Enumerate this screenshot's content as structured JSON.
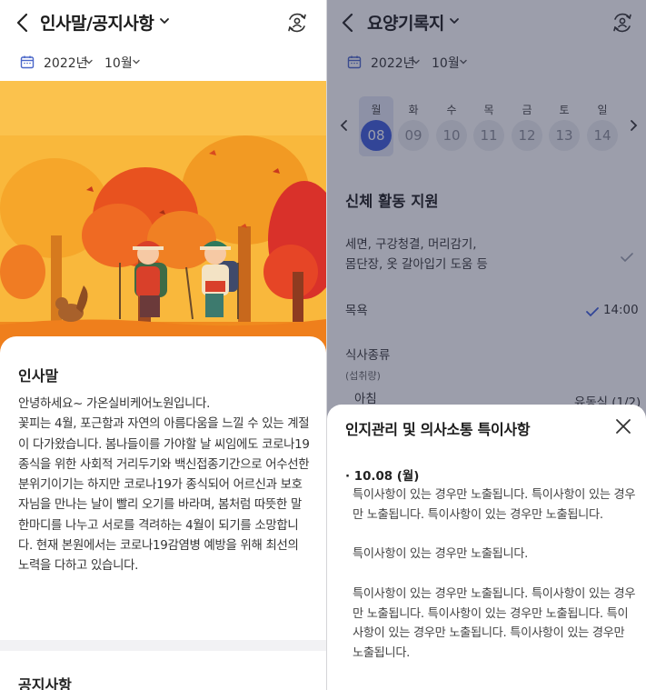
{
  "left": {
    "header": {
      "title": "인사말/공지사항",
      "icons": {
        "back": "chevron-left-icon",
        "dropdown": "chevron-down-icon",
        "profile": "user-switch-icon"
      }
    },
    "date_filter": {
      "year": "2022년",
      "month": "10월",
      "icon": "calendar-icon"
    },
    "greeting": {
      "heading": "인사말",
      "lines": [
        "안녕하세요~ 가온실비케어노원입니다.",
        "꽃피는 4월, 포근함과 자연의 아름다움을 느낄 수 있는 계절이 다가왔습니다. 봄나들이를 가야할 날 씨임에도 코로나19종식을 위한 사회적 거리두기와 백신접종기간으로 어수선한 분위기이기는 하지만 코로나19가 종식되어 어르신과 보호자님을 만나는 날이 빨리 오기를 바라며, 봄처럼 따뜻한 말 한마디를 나누고 서로를 격려하는 4월이 되기를 소망합니다. 현재 본원에서는 코로나19감염병 예방을 위해 최선의 노력을 다하고 있습니다."
      ]
    },
    "notice": {
      "heading": "공지사항"
    }
  },
  "right": {
    "header": {
      "title": "요양기록지",
      "icons": {
        "back": "chevron-left-icon",
        "dropdown": "chevron-down-icon",
        "profile": "user-switch-icon"
      }
    },
    "date_filter": {
      "year": "2022년",
      "month": "10월",
      "icon": "calendar-icon"
    },
    "week": {
      "days": [
        {
          "name": "월",
          "date": "08",
          "selected": true
        },
        {
          "name": "화",
          "date": "09",
          "selected": false
        },
        {
          "name": "수",
          "date": "10",
          "selected": false
        },
        {
          "name": "목",
          "date": "11",
          "selected": false
        },
        {
          "name": "금",
          "date": "12",
          "selected": false
        },
        {
          "name": "토",
          "date": "13",
          "selected": false
        },
        {
          "name": "일",
          "date": "14",
          "selected": false
        }
      ]
    },
    "section": {
      "title": "신체 활동 지원",
      "rows": [
        {
          "label_line1": "세면, 구강청결, 머리감기,",
          "label_line2": "몸단장, 옷 갈아입기 도움 등"
        },
        {
          "label": "목욕",
          "time": "14:00"
        },
        {
          "label": "식사종류",
          "sub": "(섭취량)"
        },
        {
          "label": "아침",
          "value": "유동식 (1/2)"
        }
      ]
    },
    "sheet": {
      "title": "인지관리 및 의사소통 특이사항",
      "date": "· 10.08 (월)",
      "paragraphs": [
        "특이사항이 있는 경우만 노출됩니다. 특이사항이 있는 경우만 노출됩니다. 특이사항이 있는 경우만 노출됩니다.",
        "특이사항이 있는 경우만 노출됩니다.",
        "특이사항이 있는 경우만 노출됩니다. 특이사항이 있는 경우만 노출됩니다. 특이사항이 있는 경우만 노출됩니다. 특이사항이 있는 경우만 노출됩니다. 특이사항이 있는 경우만 노출됩니다."
      ],
      "icons": {
        "close": "close-icon"
      }
    }
  },
  "colors": {
    "accent": "#3b5bdb",
    "hero_bg": "#f9b83c",
    "dim_overlay": "#282c48"
  }
}
